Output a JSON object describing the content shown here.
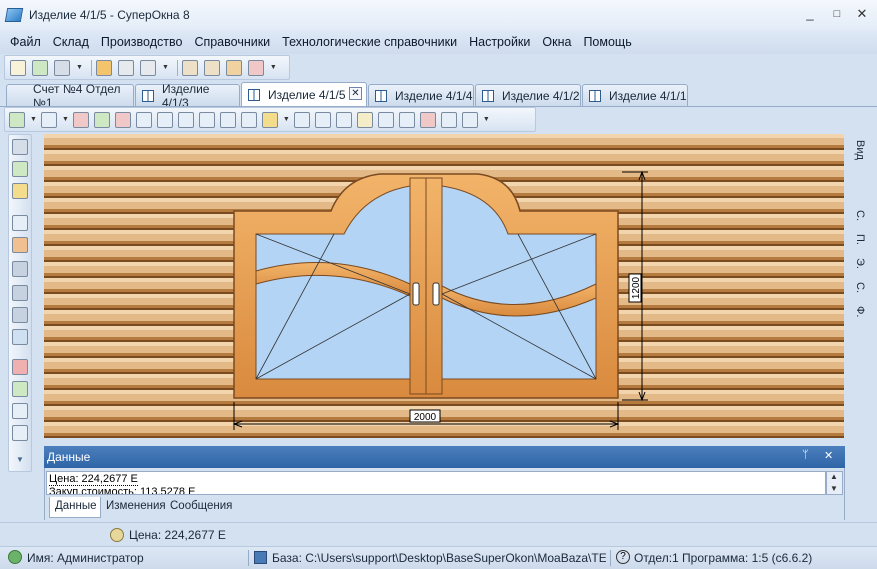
{
  "window": {
    "title": "Изделие 4/1/5 - СуперОкна 8",
    "minimize": "_",
    "maximize": "□",
    "close": "✕"
  },
  "menu": [
    "Файл",
    "Склад",
    "Производство",
    "Справочники",
    "Технологические справочники",
    "Настройки",
    "Окна",
    "Помощь"
  ],
  "tabs": [
    {
      "label": "Счет №4 Отдел №1"
    },
    {
      "label": "Изделие 4/1/3"
    },
    {
      "label": "Изделие 4/1/5",
      "active": true,
      "close": "✕"
    },
    {
      "label": "Изделие 4/1/4"
    },
    {
      "label": "Изделие 4/1/2"
    },
    {
      "label": "Изделие 4/1/1"
    }
  ],
  "drawing": {
    "height_dim": "1200",
    "width_dim": "2000"
  },
  "right_panel": {
    "vid": "Вид",
    "items": [
      "С.",
      "П.",
      "Э.",
      "С.",
      "Ф."
    ]
  },
  "data_panel": {
    "title": "Данные",
    "pin": "ᛘ",
    "close": "✕",
    "rows": [
      "Цена: 224,2677 E",
      "Закуп.стоимость: 113,5278 E"
    ],
    "tabs": [
      "Данные",
      "Изменения",
      "Сообщения"
    ]
  },
  "status": {
    "price": "Цена: 224,2677 E",
    "user": "Имя: Администратор",
    "base": "База: C:\\Users\\support\\Desktop\\BaseSuperOkon\\MoaBaza\\TEST.F",
    "dept": "Отдел:1 Программа: 1:5 (c6.6.2)"
  },
  "colors": {
    "accent": "#2f64a7",
    "wood": "#d9a465",
    "glass": "#b3d4f5",
    "frame": "#e8a45a"
  }
}
